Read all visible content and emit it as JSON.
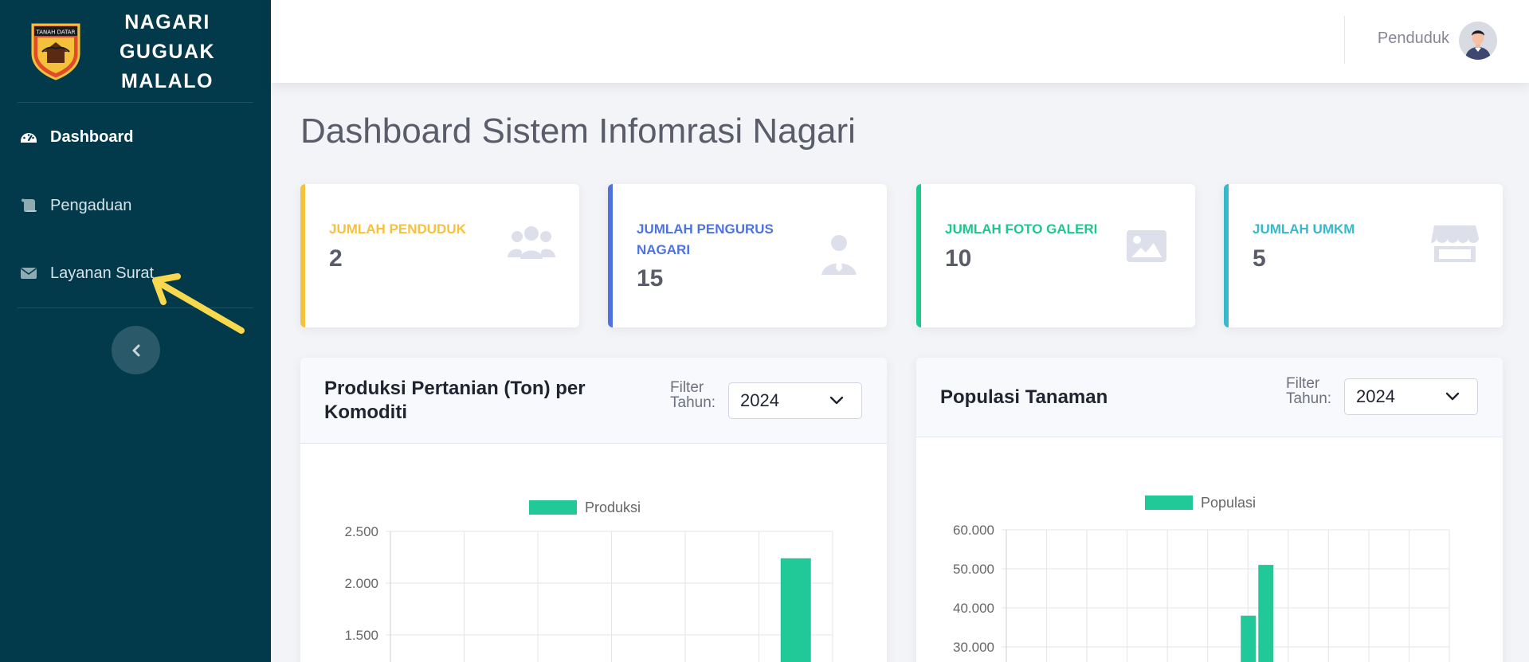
{
  "brand": {
    "lines": [
      "NAGARI",
      "GUGUAK",
      "MALALO"
    ],
    "logo_text": "TANAH DATAR"
  },
  "sidebar": {
    "items": [
      {
        "label": "Dashboard",
        "icon": "tachometer-icon",
        "active": true
      },
      {
        "label": "Pengaduan",
        "icon": "scroll-icon",
        "active": false
      },
      {
        "label": "Layanan Surat",
        "icon": "envelope-icon",
        "active": false
      }
    ],
    "toggle_icon": "chevron-left-icon"
  },
  "topbar": {
    "user_name": "Penduduk",
    "avatar_icon": "user-avatar-icon"
  },
  "page": {
    "title": "Dashboard Sistem Infomrasi Nagari"
  },
  "cards": [
    {
      "label": "JUMLAH PENDUDUK",
      "value": "2",
      "color": "#f6c23e",
      "icon": "users-icon"
    },
    {
      "label": "JUMLAH PENGURUS NAGARI",
      "value": "15",
      "color": "#4e73df",
      "icon": "user-tie-icon"
    },
    {
      "label": "JUMLAH FOTO GALERI",
      "value": "10",
      "color": "#1cc88a",
      "icon": "image-icon"
    },
    {
      "label": "JUMLAH UMKM",
      "value": "5",
      "color": "#36b9cc",
      "icon": "store-icon"
    }
  ],
  "colors": {
    "sidebar_bg": "#023a4b",
    "bar": "#20c997",
    "annotation": "#f8d94e"
  },
  "chart_data": [
    {
      "type": "bar",
      "title": "Produksi Pertanian (Ton) per Komoditi",
      "filter_label": "Filter Tahun:",
      "filter_value": "2024",
      "series": [
        {
          "name": "Produksi",
          "values": [
            null,
            null,
            null,
            null,
            null,
            2240
          ]
        }
      ],
      "y_ticks": [
        "2.500",
        "2.000",
        "1.500"
      ],
      "y_tick_values": [
        2500,
        2000,
        1500
      ],
      "ylim_visible": [
        1500,
        2500
      ],
      "category_count": 6,
      "grid": true,
      "legend": "top"
    },
    {
      "type": "bar",
      "title": "Populasi Tanaman",
      "filter_label": "Filter Tahun:",
      "filter_value": "2024",
      "series": [
        {
          "name": "Populasi",
          "values": [
            null,
            null,
            null,
            null,
            null,
            38000,
            51000,
            null,
            null,
            null,
            null
          ]
        }
      ],
      "y_ticks": [
        "60.000",
        "50.000",
        "40.000",
        "30.000"
      ],
      "y_tick_values": [
        60000,
        50000,
        40000,
        30000
      ],
      "ylim_visible": [
        30000,
        60000
      ],
      "category_count": 11,
      "grid": true,
      "legend": "top"
    }
  ]
}
